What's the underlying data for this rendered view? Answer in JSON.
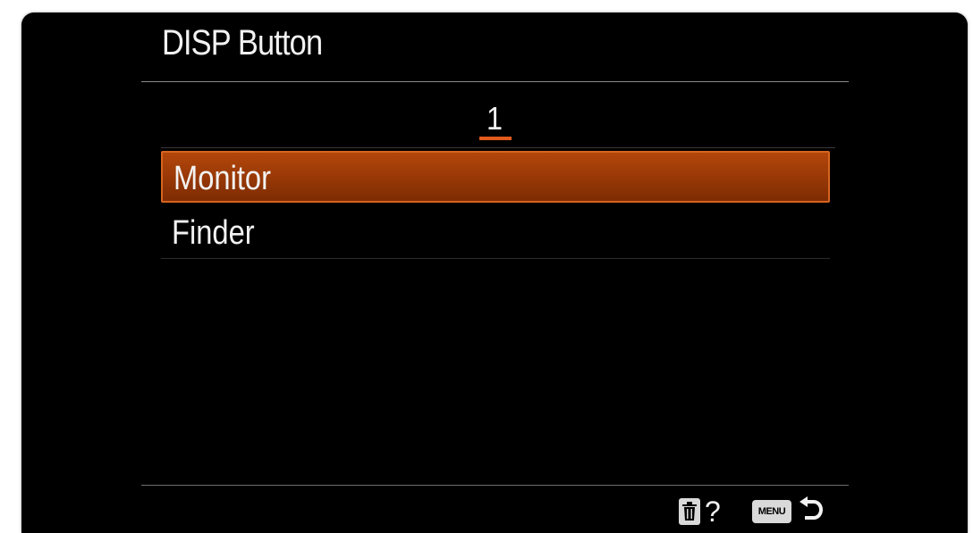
{
  "screen": {
    "title": "DISP Button",
    "page_tab": "1",
    "items": [
      {
        "label": "Monitor",
        "selected": true
      },
      {
        "label": "Finder",
        "selected": false
      }
    ],
    "footer": {
      "help_label": "?",
      "menu_label": "MENU",
      "icons": [
        "trash-icon",
        "help-icon",
        "menu-button",
        "back-arrow-icon"
      ]
    }
  },
  "colors": {
    "background": "#000000",
    "accent": "#e25a1c",
    "selected_fill": "#9c3a07",
    "text": "#f2f2f2"
  }
}
